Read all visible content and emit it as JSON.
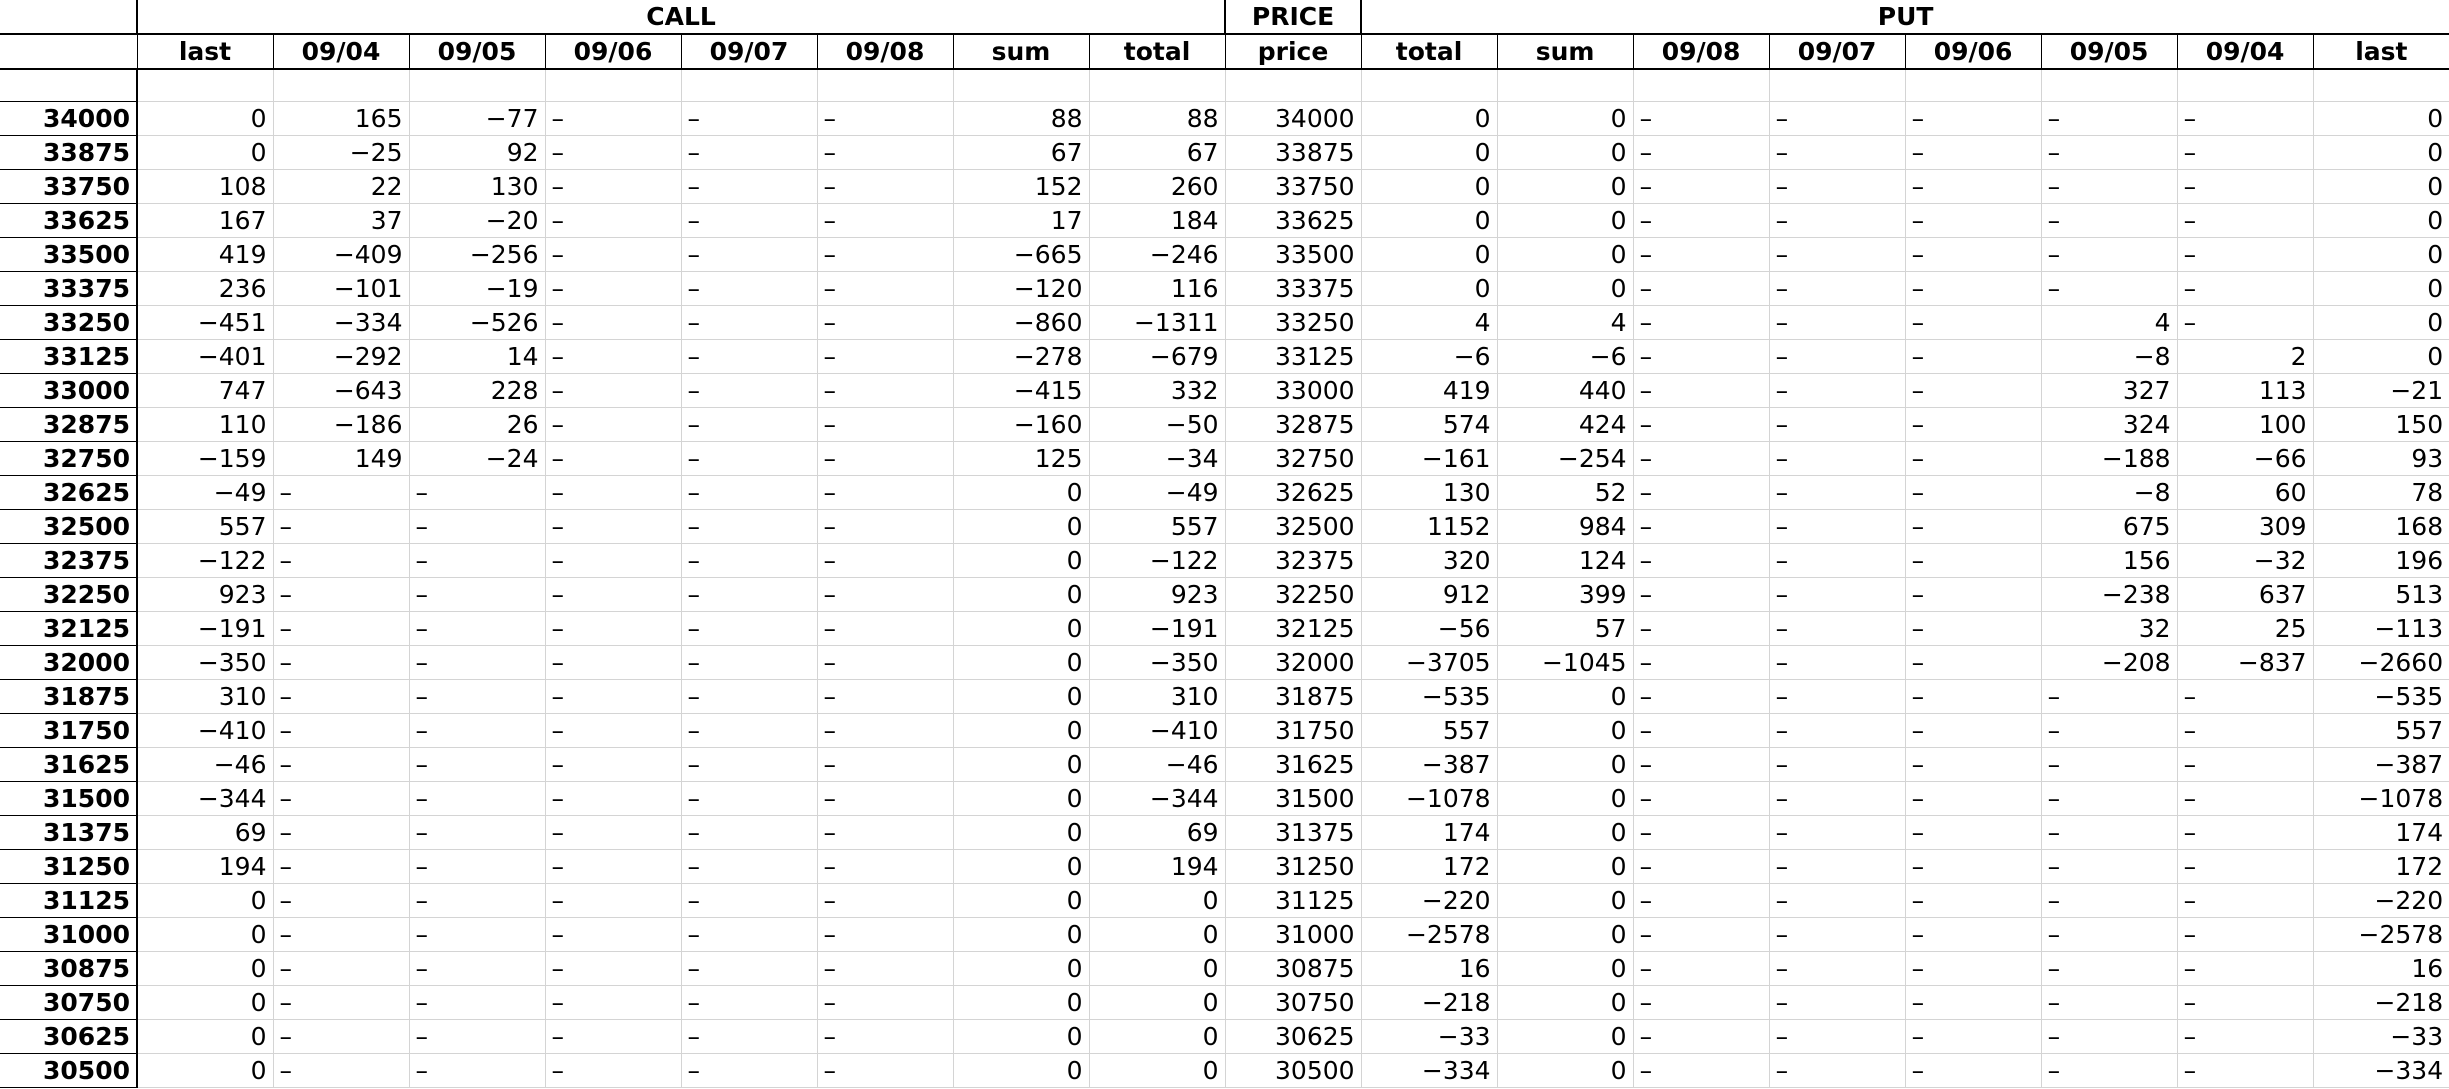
{
  "header": {
    "groups": [
      {
        "label": "",
        "span": 1
      },
      {
        "label": "CALL",
        "span": 8
      },
      {
        "label": "PRICE",
        "span": 1
      },
      {
        "label": "PUT",
        "span": 8
      }
    ],
    "columns": [
      "",
      "last",
      "09/04",
      "09/05",
      "09/06",
      "09/07",
      "09/08",
      "sum",
      "total",
      "price",
      "total",
      "sum",
      "09/08",
      "09/07",
      "09/06",
      "09/05",
      "09/04",
      "last"
    ]
  },
  "rows": [
    [
      "34000",
      "0",
      "165",
      "-77",
      "-",
      "-",
      "-",
      "88",
      "88",
      "34000",
      "0",
      "0",
      "-",
      "-",
      "-",
      "-",
      "-",
      "0"
    ],
    [
      "33875",
      "0",
      "-25",
      "92",
      "-",
      "-",
      "-",
      "67",
      "67",
      "33875",
      "0",
      "0",
      "-",
      "-",
      "-",
      "-",
      "-",
      "0"
    ],
    [
      "33750",
      "108",
      "22",
      "130",
      "-",
      "-",
      "-",
      "152",
      "260",
      "33750",
      "0",
      "0",
      "-",
      "-",
      "-",
      "-",
      "-",
      "0"
    ],
    [
      "33625",
      "167",
      "37",
      "-20",
      "-",
      "-",
      "-",
      "17",
      "184",
      "33625",
      "0",
      "0",
      "-",
      "-",
      "-",
      "-",
      "-",
      "0"
    ],
    [
      "33500",
      "419",
      "-409",
      "-256",
      "-",
      "-",
      "-",
      "-665",
      "-246",
      "33500",
      "0",
      "0",
      "-",
      "-",
      "-",
      "-",
      "-",
      "0"
    ],
    [
      "33375",
      "236",
      "-101",
      "-19",
      "-",
      "-",
      "-",
      "-120",
      "116",
      "33375",
      "0",
      "0",
      "-",
      "-",
      "-",
      "-",
      "-",
      "0"
    ],
    [
      "33250",
      "-451",
      "-334",
      "-526",
      "-",
      "-",
      "-",
      "-860",
      "-1311",
      "33250",
      "4",
      "4",
      "-",
      "-",
      "-",
      "4",
      "-",
      "0"
    ],
    [
      "33125",
      "-401",
      "-292",
      "14",
      "-",
      "-",
      "-",
      "-278",
      "-679",
      "33125",
      "-6",
      "-6",
      "-",
      "-",
      "-",
      "-8",
      "2",
      "0"
    ],
    [
      "33000",
      "747",
      "-643",
      "228",
      "-",
      "-",
      "-",
      "-415",
      "332",
      "33000",
      "419",
      "440",
      "-",
      "-",
      "-",
      "327",
      "113",
      "-21"
    ],
    [
      "32875",
      "110",
      "-186",
      "26",
      "-",
      "-",
      "-",
      "-160",
      "-50",
      "32875",
      "574",
      "424",
      "-",
      "-",
      "-",
      "324",
      "100",
      "150"
    ],
    [
      "32750",
      "-159",
      "149",
      "-24",
      "-",
      "-",
      "-",
      "125",
      "-34",
      "32750",
      "-161",
      "-254",
      "-",
      "-",
      "-",
      "-188",
      "-66",
      "93"
    ],
    [
      "32625",
      "-49",
      "-",
      "-",
      "-",
      "-",
      "-",
      "0",
      "-49",
      "32625",
      "130",
      "52",
      "-",
      "-",
      "-",
      "-8",
      "60",
      "78"
    ],
    [
      "32500",
      "557",
      "-",
      "-",
      "-",
      "-",
      "-",
      "0",
      "557",
      "32500",
      "1152",
      "984",
      "-",
      "-",
      "-",
      "675",
      "309",
      "168"
    ],
    [
      "32375",
      "-122",
      "-",
      "-",
      "-",
      "-",
      "-",
      "0",
      "-122",
      "32375",
      "320",
      "124",
      "-",
      "-",
      "-",
      "156",
      "-32",
      "196"
    ],
    [
      "32250",
      "923",
      "-",
      "-",
      "-",
      "-",
      "-",
      "0",
      "923",
      "32250",
      "912",
      "399",
      "-",
      "-",
      "-",
      "-238",
      "637",
      "513"
    ],
    [
      "32125",
      "-191",
      "-",
      "-",
      "-",
      "-",
      "-",
      "0",
      "-191",
      "32125",
      "-56",
      "57",
      "-",
      "-",
      "-",
      "32",
      "25",
      "-113"
    ],
    [
      "32000",
      "-350",
      "-",
      "-",
      "-",
      "-",
      "-",
      "0",
      "-350",
      "32000",
      "-3705",
      "-1045",
      "-",
      "-",
      "-",
      "-208",
      "-837",
      "-2660"
    ],
    [
      "31875",
      "310",
      "-",
      "-",
      "-",
      "-",
      "-",
      "0",
      "310",
      "31875",
      "-535",
      "0",
      "-",
      "-",
      "-",
      "-",
      "-",
      "-535"
    ],
    [
      "31750",
      "-410",
      "-",
      "-",
      "-",
      "-",
      "-",
      "0",
      "-410",
      "31750",
      "557",
      "0",
      "-",
      "-",
      "-",
      "-",
      "-",
      "557"
    ],
    [
      "31625",
      "-46",
      "-",
      "-",
      "-",
      "-",
      "-",
      "0",
      "-46",
      "31625",
      "-387",
      "0",
      "-",
      "-",
      "-",
      "-",
      "-",
      "-387"
    ],
    [
      "31500",
      "-344",
      "-",
      "-",
      "-",
      "-",
      "-",
      "0",
      "-344",
      "31500",
      "-1078",
      "0",
      "-",
      "-",
      "-",
      "-",
      "-",
      "-1078"
    ],
    [
      "31375",
      "69",
      "-",
      "-",
      "-",
      "-",
      "-",
      "0",
      "69",
      "31375",
      "174",
      "0",
      "-",
      "-",
      "-",
      "-",
      "-",
      "174"
    ],
    [
      "31250",
      "194",
      "-",
      "-",
      "-",
      "-",
      "-",
      "0",
      "194",
      "31250",
      "172",
      "0",
      "-",
      "-",
      "-",
      "-",
      "-",
      "172"
    ],
    [
      "31125",
      "0",
      "-",
      "-",
      "-",
      "-",
      "-",
      "0",
      "0",
      "31125",
      "-220",
      "0",
      "-",
      "-",
      "-",
      "-",
      "-",
      "-220"
    ],
    [
      "31000",
      "0",
      "-",
      "-",
      "-",
      "-",
      "-",
      "0",
      "0",
      "31000",
      "-2578",
      "0",
      "-",
      "-",
      "-",
      "-",
      "-",
      "-2578"
    ],
    [
      "30875",
      "0",
      "-",
      "-",
      "-",
      "-",
      "-",
      "0",
      "0",
      "30875",
      "16",
      "0",
      "-",
      "-",
      "-",
      "-",
      "-",
      "16"
    ],
    [
      "30750",
      "0",
      "-",
      "-",
      "-",
      "-",
      "-",
      "0",
      "0",
      "30750",
      "-218",
      "0",
      "-",
      "-",
      "-",
      "-",
      "-",
      "-218"
    ],
    [
      "30625",
      "0",
      "-",
      "-",
      "-",
      "-",
      "-",
      "0",
      "0",
      "30625",
      "-33",
      "0",
      "-",
      "-",
      "-",
      "-",
      "-",
      "-33"
    ],
    [
      "30500",
      "0",
      "-",
      "-",
      "-",
      "-",
      "-",
      "0",
      "0",
      "30500",
      "-334",
      "0",
      "-",
      "-",
      "-",
      "-",
      "-",
      "-334"
    ]
  ]
}
